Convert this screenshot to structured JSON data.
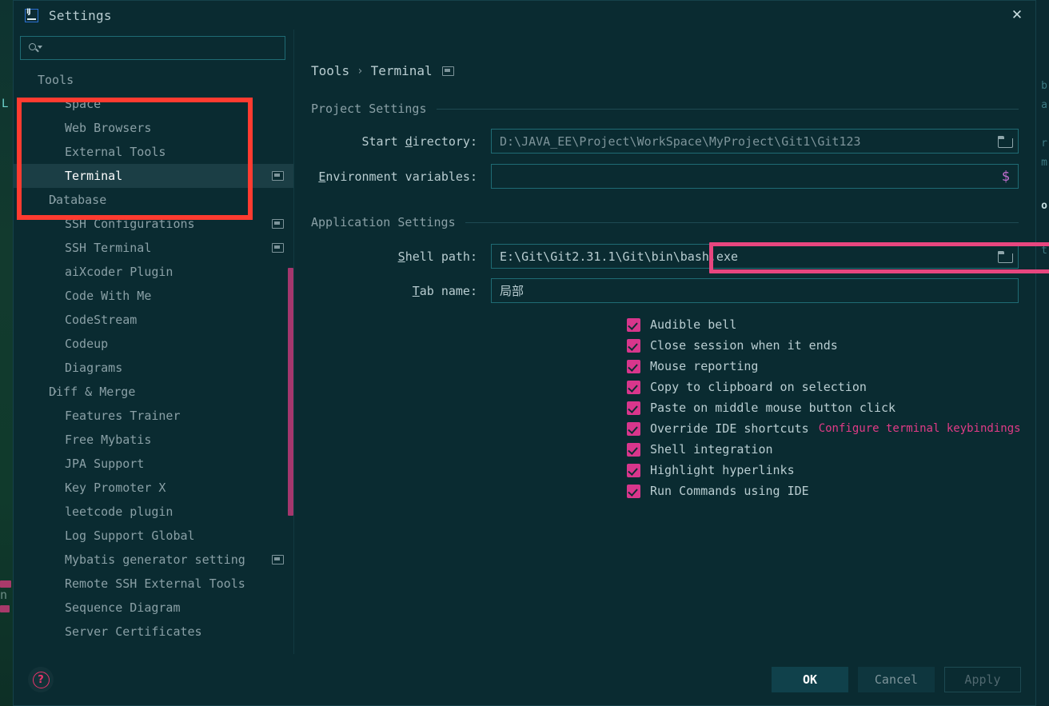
{
  "window": {
    "title": "Settings",
    "logo_icon": "intellij-idea-logo-icon",
    "close_icon": "✕"
  },
  "sidebar": {
    "search": {
      "value": "",
      "placeholder": "",
      "icon": "search-icon"
    },
    "items": [
      {
        "label": "Tools",
        "level": "top",
        "arrow": "",
        "badge": false,
        "selected": false
      },
      {
        "label": "Space",
        "level": "child",
        "arrow": "",
        "badge": false,
        "selected": false
      },
      {
        "label": "Web Browsers",
        "level": "child",
        "arrow": "",
        "badge": false,
        "selected": false
      },
      {
        "label": "External Tools",
        "level": "child",
        "arrow": "",
        "badge": false,
        "selected": false
      },
      {
        "label": "Terminal",
        "level": "child",
        "arrow": "",
        "badge": true,
        "selected": true
      },
      {
        "label": "Database",
        "level": "child-arrow",
        "arrow": "›",
        "badge": false,
        "selected": false
      },
      {
        "label": "SSH Configurations",
        "level": "child",
        "arrow": "",
        "badge": true,
        "selected": false
      },
      {
        "label": "SSH Terminal",
        "level": "child",
        "arrow": "",
        "badge": true,
        "selected": false
      },
      {
        "label": "aiXcoder Plugin",
        "level": "child",
        "arrow": "",
        "badge": false,
        "selected": false
      },
      {
        "label": "Code With Me",
        "level": "child",
        "arrow": "",
        "badge": false,
        "selected": false
      },
      {
        "label": "CodeStream",
        "level": "child",
        "arrow": "",
        "badge": false,
        "selected": false
      },
      {
        "label": "Codeup",
        "level": "child",
        "arrow": "",
        "badge": false,
        "selected": false
      },
      {
        "label": "Diagrams",
        "level": "child",
        "arrow": "",
        "badge": false,
        "selected": false
      },
      {
        "label": "Diff & Merge",
        "level": "child-arrow",
        "arrow": "›",
        "badge": false,
        "selected": false
      },
      {
        "label": "Features Trainer",
        "level": "child",
        "arrow": "",
        "badge": false,
        "selected": false
      },
      {
        "label": "Free Mybatis",
        "level": "child",
        "arrow": "",
        "badge": false,
        "selected": false
      },
      {
        "label": "JPA Support",
        "level": "child",
        "arrow": "",
        "badge": false,
        "selected": false
      },
      {
        "label": "Key Promoter X",
        "level": "child",
        "arrow": "",
        "badge": false,
        "selected": false
      },
      {
        "label": "leetcode plugin",
        "level": "child",
        "arrow": "",
        "badge": false,
        "selected": false
      },
      {
        "label": "Log Support Global",
        "level": "child",
        "arrow": "",
        "badge": false,
        "selected": false
      },
      {
        "label": "Mybatis generator setting",
        "level": "child",
        "arrow": "",
        "badge": true,
        "selected": false
      },
      {
        "label": "Remote SSH External Tools",
        "level": "child",
        "arrow": "",
        "badge": false,
        "selected": false
      },
      {
        "label": "Sequence Diagram",
        "level": "child",
        "arrow": "",
        "badge": false,
        "selected": false
      },
      {
        "label": "Server Certificates",
        "level": "child",
        "arrow": "",
        "badge": false,
        "selected": false
      }
    ]
  },
  "main": {
    "breadcrumb": {
      "root": "Tools",
      "separator": "›",
      "leaf": "Terminal",
      "badge_icon": "project-level-setting-icon"
    },
    "project_settings": {
      "heading": "Project Settings",
      "start_directory": {
        "label_pre": "Start ",
        "label_accel": "d",
        "label_post": "irectory:",
        "value": "D:\\JAVA_EE\\Project\\WorkSpace\\MyProject\\Git1\\Git123",
        "browse_icon": "folder-icon"
      },
      "environment_variables": {
        "label_pre": "",
        "label_accel": "E",
        "label_post": "nvironment variables:",
        "value": "",
        "macro_icon": "$"
      }
    },
    "application_settings": {
      "heading": "Application Settings",
      "shell_path": {
        "label_pre": "",
        "label_accel": "S",
        "label_post": "hell path:",
        "value": "E:\\Git\\Git2.31.1\\Git\\bin\\bash.exe",
        "browse_icon": "folder-icon"
      },
      "tab_name": {
        "label_pre": "",
        "label_accel": "T",
        "label_post": "ab name:",
        "value": "局部"
      },
      "checkboxes": [
        {
          "label": "Audible bell",
          "checked": true,
          "link": null
        },
        {
          "label": "Close session when it ends",
          "checked": true,
          "link": null
        },
        {
          "label": "Mouse reporting",
          "checked": true,
          "link": null
        },
        {
          "label": "Copy to clipboard on selection",
          "checked": true,
          "link": null
        },
        {
          "label": "Paste on middle mouse button click",
          "checked": true,
          "link": null
        },
        {
          "label": "Override IDE shortcuts",
          "checked": true,
          "link": "Configure terminal keybindings"
        },
        {
          "label": "Shell integration",
          "checked": true,
          "link": null
        },
        {
          "label": "Highlight hyperlinks",
          "checked": true,
          "link": null
        },
        {
          "label": "Run Commands using IDE",
          "checked": true,
          "link": null
        }
      ]
    }
  },
  "footer": {
    "help_icon": "help-question-icon",
    "help_glyph": "?",
    "ok": "OK",
    "cancel": "Cancel",
    "apply": "Apply"
  },
  "background": {
    "left_letter": "L",
    "left_word": "n",
    "right_lines": [
      "b",
      "a",
      "r",
      "m",
      "o",
      "t"
    ]
  },
  "annotations": {
    "tools_box_color": "#ff3b30",
    "shell_path_box_color": "#e8467f"
  },
  "colors": {
    "dialog_bg": "#0a2b31",
    "accent_pink": "#d8368c",
    "selection_bg": "#1b3e45",
    "scrollbar": "#a4376d",
    "text_primary": "#b9cdd1",
    "text_muted": "#7d949a",
    "field_border": "#1f6b74"
  }
}
